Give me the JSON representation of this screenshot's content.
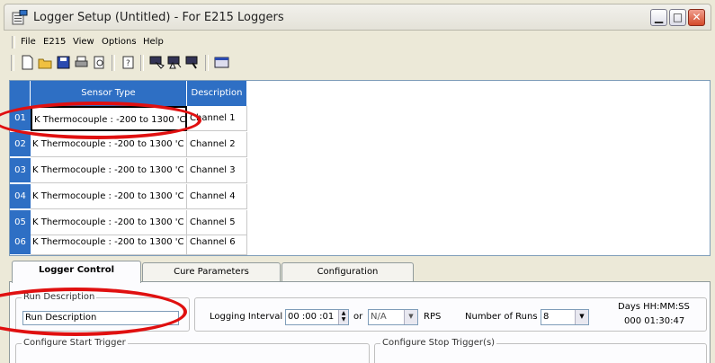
{
  "window": {
    "title": "Logger Setup (Untitled) - For E215 Loggers",
    "minimize_glyph": "▁",
    "maximize_glyph": "□",
    "close_glyph": "✕"
  },
  "menu": [
    "File",
    "E215",
    "View",
    "Options",
    "Help"
  ],
  "toolbar": {
    "icons": [
      "new-file-icon",
      "open-folder-icon",
      "save-icon",
      "print-icon",
      "print-preview-icon",
      "help-icon",
      "logger-download-icon",
      "logger-upload-icon",
      "logger-connect-icon",
      "data-view-icon"
    ]
  },
  "grid": {
    "headers": [
      "Sensor Type",
      "Description"
    ],
    "rows": [
      {
        "num": "01",
        "sensor": "K Thermocouple : -200  to 1300 'C",
        "description": "Channel  1"
      },
      {
        "num": "02",
        "sensor": "K Thermocouple : -200  to 1300 'C",
        "description": "Channel  2"
      },
      {
        "num": "03",
        "sensor": "K Thermocouple : -200  to 1300 'C",
        "description": "Channel  3"
      },
      {
        "num": "04",
        "sensor": "K Thermocouple : -200  to 1300 'C",
        "description": "Channel  4"
      },
      {
        "num": "05",
        "sensor": "K Thermocouple : -200  to 1300 'C",
        "description": "Channel  5"
      },
      {
        "num": "06",
        "sensor": "K Thermocouple : -200  to 1300 'C",
        "description": "Channel  6"
      }
    ]
  },
  "tabs": [
    "Logger Control",
    "Cure Parameters",
    "Configuration"
  ],
  "logger_control": {
    "run_description_group": "Run Description",
    "run_description_value": "Run Description",
    "logging_interval_label": "Logging Interval",
    "logging_interval_value": "00 :00 :01",
    "or_label": "or",
    "rps_value": "N/A",
    "rps_label": "RPS",
    "number_of_runs_label": "Number of Runs",
    "number_of_runs_value": "8",
    "days_header": "Days  HH:MM:SS",
    "duration_value": "000  01:30:47",
    "start_trigger_group": "Configure Start Trigger",
    "stop_trigger_group": "Configure Stop Trigger(s)"
  },
  "colors": {
    "grid_header": "#2e6fc4",
    "annotation": "#e01010"
  }
}
